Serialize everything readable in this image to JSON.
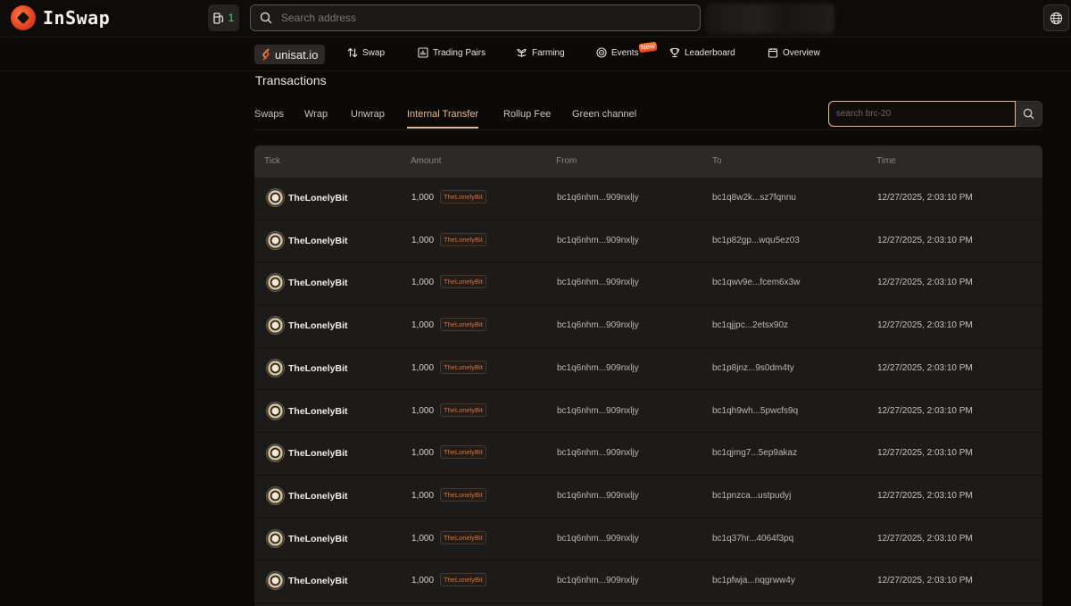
{
  "brand": {
    "name": "InSwap"
  },
  "header": {
    "fuel_count": "1",
    "search_placeholder": "Search address"
  },
  "nav": {
    "unisat_label": "unisat.io",
    "items": [
      {
        "label": "Swap",
        "icon": "swap-icon"
      },
      {
        "label": "Trading Pairs",
        "icon": "chart-icon"
      },
      {
        "label": "Farming",
        "icon": "sprout-icon"
      },
      {
        "label": "Events",
        "icon": "target-icon"
      },
      {
        "label": "Leaderboard",
        "icon": "trophy-icon"
      },
      {
        "label": "Overview",
        "icon": "calendar-icon"
      }
    ],
    "new_badge": "New"
  },
  "page": {
    "title": "Transactions",
    "tabs": [
      "Swaps",
      "Wrap",
      "Unwrap",
      "Internal Transfer",
      "Rollup Fee",
      "Green channel"
    ],
    "active_tab": "Internal Transfer",
    "tick_search_placeholder": "search brc-20"
  },
  "table": {
    "columns": [
      "Tick",
      "Amount",
      "From",
      "To",
      "Time"
    ],
    "rows": [
      {
        "tick": "TheLonelyBit",
        "amount": "1,000",
        "tag": "TheLonelyBit",
        "from": "bc1q6nhm...909nxljy",
        "to": "bc1q8w2k...sz7fqnnu",
        "time": "12/27/2025, 2:03:10 PM"
      },
      {
        "tick": "TheLonelyBit",
        "amount": "1,000",
        "tag": "TheLonelyBit",
        "from": "bc1q6nhm...909nxljy",
        "to": "bc1p82gp...wqu5ez03",
        "time": "12/27/2025, 2:03:10 PM"
      },
      {
        "tick": "TheLonelyBit",
        "amount": "1,000",
        "tag": "TheLonelyBit",
        "from": "bc1q6nhm...909nxljy",
        "to": "bc1qwv9e...fcem6x3w",
        "time": "12/27/2025, 2:03:10 PM"
      },
      {
        "tick": "TheLonelyBit",
        "amount": "1,000",
        "tag": "TheLonelyBit",
        "from": "bc1q6nhm...909nxljy",
        "to": "bc1qjjpc...2etsx90z",
        "time": "12/27/2025, 2:03:10 PM"
      },
      {
        "tick": "TheLonelyBit",
        "amount": "1,000",
        "tag": "TheLonelyBit",
        "from": "bc1q6nhm...909nxljy",
        "to": "bc1p8jnz...9s0dm4ty",
        "time": "12/27/2025, 2:03:10 PM"
      },
      {
        "tick": "TheLonelyBit",
        "amount": "1,000",
        "tag": "TheLonelyBit",
        "from": "bc1q6nhm...909nxljy",
        "to": "bc1qh9wh...5pwcfs9q",
        "time": "12/27/2025, 2:03:10 PM"
      },
      {
        "tick": "TheLonelyBit",
        "amount": "1,000",
        "tag": "TheLonelyBit",
        "from": "bc1q6nhm...909nxljy",
        "to": "bc1qjmg7...5ep9akaz",
        "time": "12/27/2025, 2:03:10 PM"
      },
      {
        "tick": "TheLonelyBit",
        "amount": "1,000",
        "tag": "TheLonelyBit",
        "from": "bc1q6nhm...909nxljy",
        "to": "bc1pnzca...ustpudyj",
        "time": "12/27/2025, 2:03:10 PM"
      },
      {
        "tick": "TheLonelyBit",
        "amount": "1,000",
        "tag": "TheLonelyBit",
        "from": "bc1q6nhm...909nxljy",
        "to": "bc1q37hr...4064f3pq",
        "time": "12/27/2025, 2:03:10 PM"
      },
      {
        "tick": "TheLonelyBit",
        "amount": "1,000",
        "tag": "TheLonelyBit",
        "from": "bc1q6nhm...909nxljy",
        "to": "bc1pfwja...nqgrww4y",
        "time": "12/27/2025, 2:03:10 PM"
      }
    ]
  },
  "colors": {
    "accent": "#e9b98a",
    "brand": "#e0401f",
    "fuel_count": "#4fd37a",
    "tag": "#d2763a"
  }
}
